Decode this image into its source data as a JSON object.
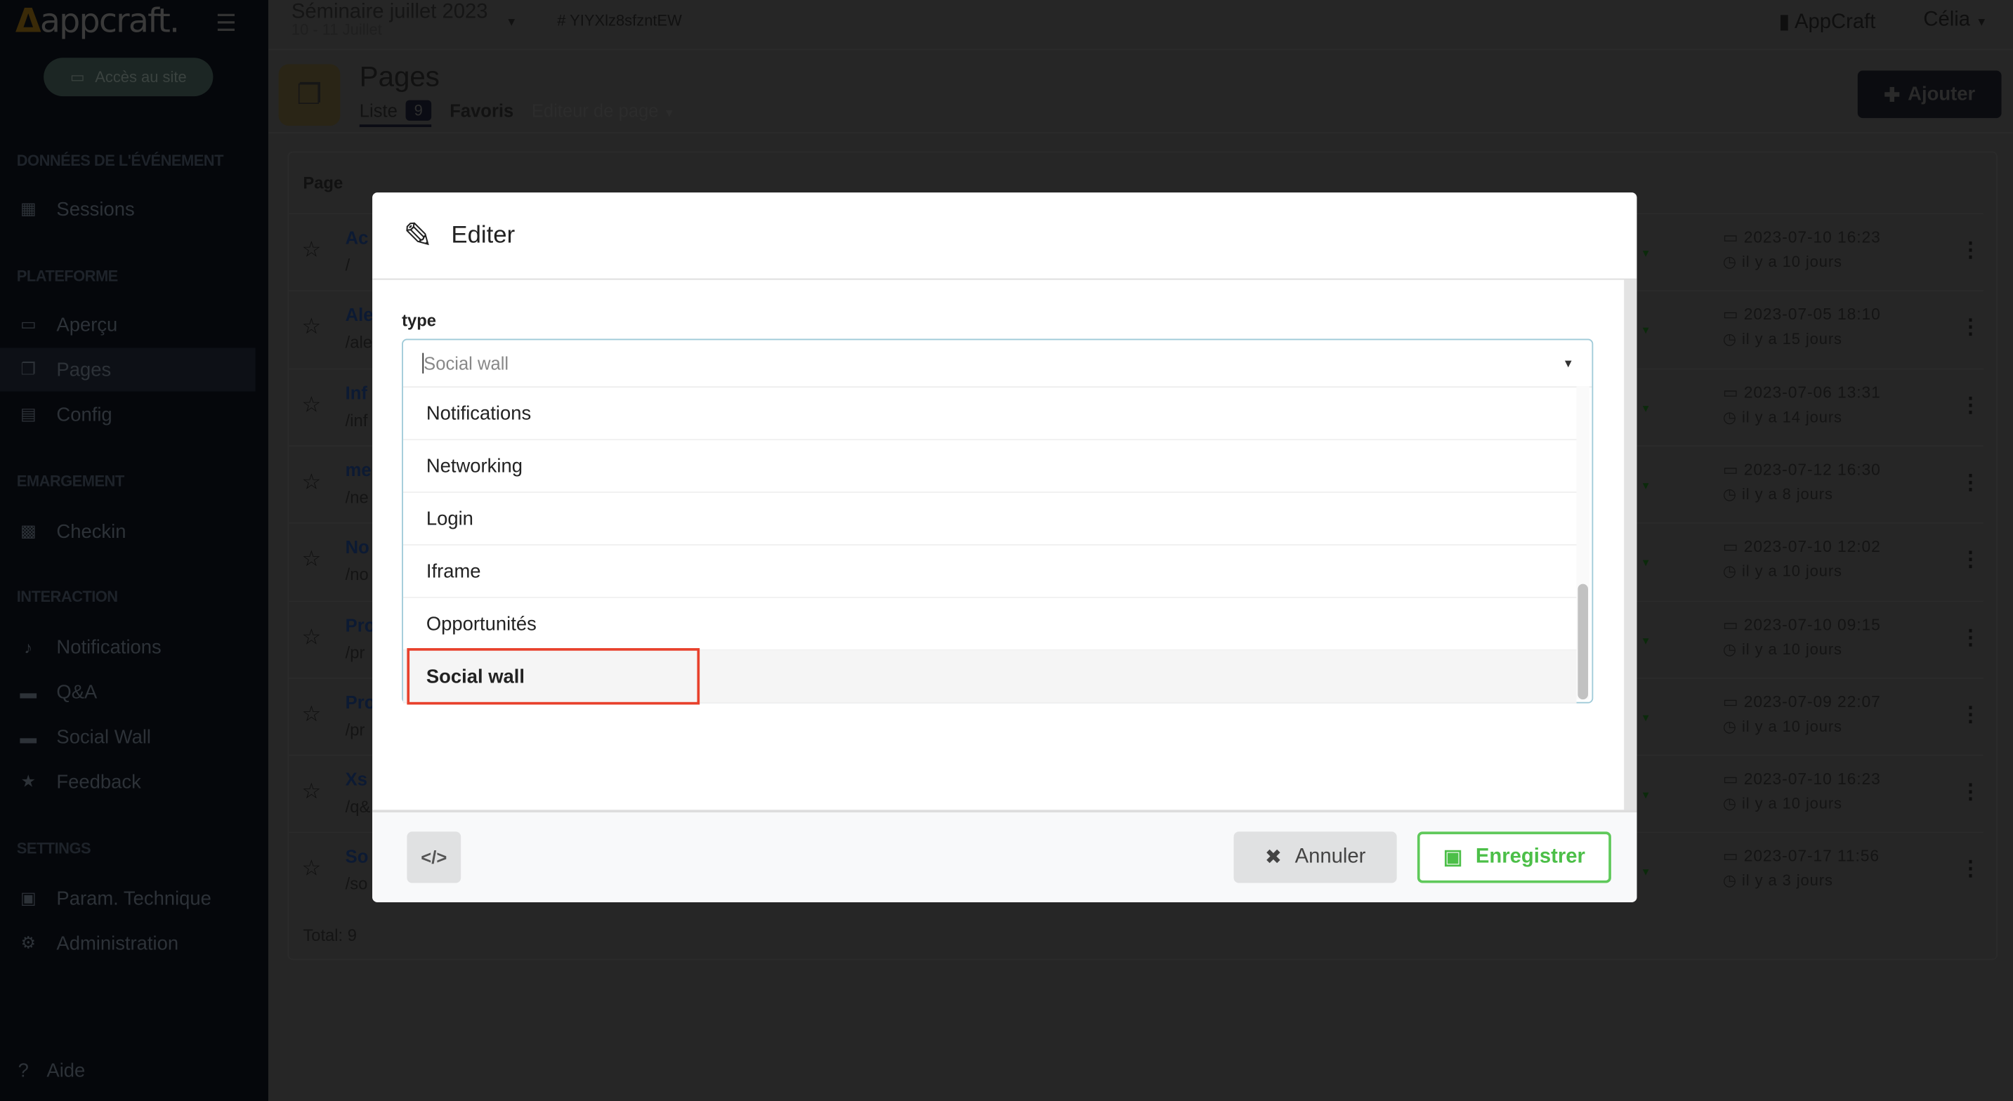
{
  "app": {
    "logo": "appcraft.",
    "site_button": "Accès au site"
  },
  "sidebar": {
    "sections": [
      {
        "title": "DONNÉES DE L'ÉVÉNEMENT",
        "items": [
          {
            "label": "Sessions",
            "icon": "calendar-icon"
          }
        ]
      },
      {
        "title": "PLATEFORME",
        "items": [
          {
            "label": "Aperçu",
            "icon": "laptop-icon"
          },
          {
            "label": "Pages",
            "icon": "copy-icon",
            "active": true
          },
          {
            "label": "Config",
            "icon": "file-icon"
          }
        ]
      },
      {
        "title": "EMARGEMENT",
        "items": [
          {
            "label": "Checkin",
            "icon": "qrcode-icon"
          }
        ]
      },
      {
        "title": "INTERACTION",
        "items": [
          {
            "label": "Notifications",
            "icon": "bell-icon"
          },
          {
            "label": "Q&A",
            "icon": "chat-icon"
          },
          {
            "label": "Social Wall",
            "icon": "comment-icon"
          },
          {
            "label": "Feedback",
            "icon": "star-icon"
          }
        ]
      },
      {
        "title": "SETTINGS",
        "items": [
          {
            "label": "Param. Technique",
            "icon": "settings-icon"
          },
          {
            "label": "Administration",
            "icon": "gear-icon"
          }
        ]
      }
    ],
    "help": "Aide"
  },
  "topbar": {
    "event_title": "Séminaire juillet 2023",
    "event_dates": "10 - 11 Juillet",
    "event_id": "# YIYXlz8sfzntEW",
    "org": "AppCraft",
    "user": "Célia"
  },
  "page": {
    "title": "Pages",
    "tabs": {
      "list": "Liste",
      "count": "9",
      "favorites": "Favoris",
      "editor": "Editeur de page"
    },
    "add_button": "Ajouter"
  },
  "table": {
    "header": "Page",
    "rows": [
      {
        "name": "Ac",
        "path": "/",
        "date": "2023-07-10 16:23",
        "ago": "il y a 10 jours"
      },
      {
        "name": "Ale",
        "path": "/ale",
        "date": "2023-07-05 18:10",
        "ago": "il y a 15 jours"
      },
      {
        "name": "Inf",
        "path": "/inf",
        "date": "2023-07-06 13:31",
        "ago": "il y a 14 jours"
      },
      {
        "name": "me",
        "path": "/ne",
        "date": "2023-07-12 16:30",
        "ago": "il y a 8 jours"
      },
      {
        "name": "No",
        "path": "/no",
        "date": "2023-07-10 12:02",
        "ago": "il y a 10 jours"
      },
      {
        "name": "Pro",
        "path": "/pr",
        "date": "2023-07-10 09:15",
        "ago": "il y a 10 jours"
      },
      {
        "name": "Pro",
        "path": "/pr",
        "date": "2023-07-09 22:07",
        "ago": "il y a 10 jours"
      },
      {
        "name": "Xs",
        "path": "/q&",
        "date": "2023-07-10 16:23",
        "ago": "il y a 10 jours"
      },
      {
        "name": "So",
        "path": "/so",
        "date": "2023-07-17 11:56",
        "ago": "il y a 3 jours"
      }
    ],
    "total": "Total: 9"
  },
  "modal": {
    "title": "Editer",
    "field_label": "type",
    "select_value": "Social wall",
    "options": [
      "Notifications",
      "Networking",
      "Login",
      "Iframe",
      "Opportunités",
      "Social wall"
    ],
    "selected_option": "Social wall",
    "cancel": "Annuler",
    "save": "Enregistrer",
    "colors": {
      "save": "#4cbf48",
      "highlight": "#e8412c",
      "select_border": "#9fcad8"
    }
  }
}
